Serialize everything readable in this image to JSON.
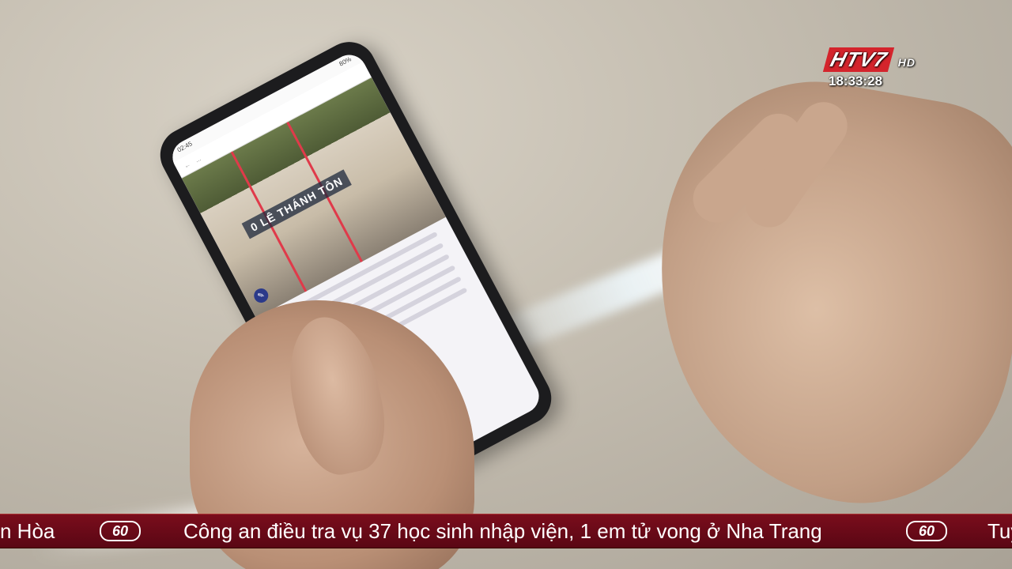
{
  "overlay": {
    "channel_logo": "HTV7",
    "channel_hd": "HD",
    "clock": "18:33:28"
  },
  "phone": {
    "status_time": "02:45",
    "status_battery": "80%",
    "url": "...",
    "street_sign": "0 LÊ THÁNH TÔN"
  },
  "ticker": {
    "segment_prev": "n Hòa",
    "logo_label": "60",
    "segment_main": "Công an điều tra vụ 37 học sinh nhập viện, 1 em tử vong ở Nha Trang",
    "segment_next": "Tuy"
  },
  "colors": {
    "ticker_bg": "#6a0a18",
    "logo_red": "#d4242c"
  }
}
